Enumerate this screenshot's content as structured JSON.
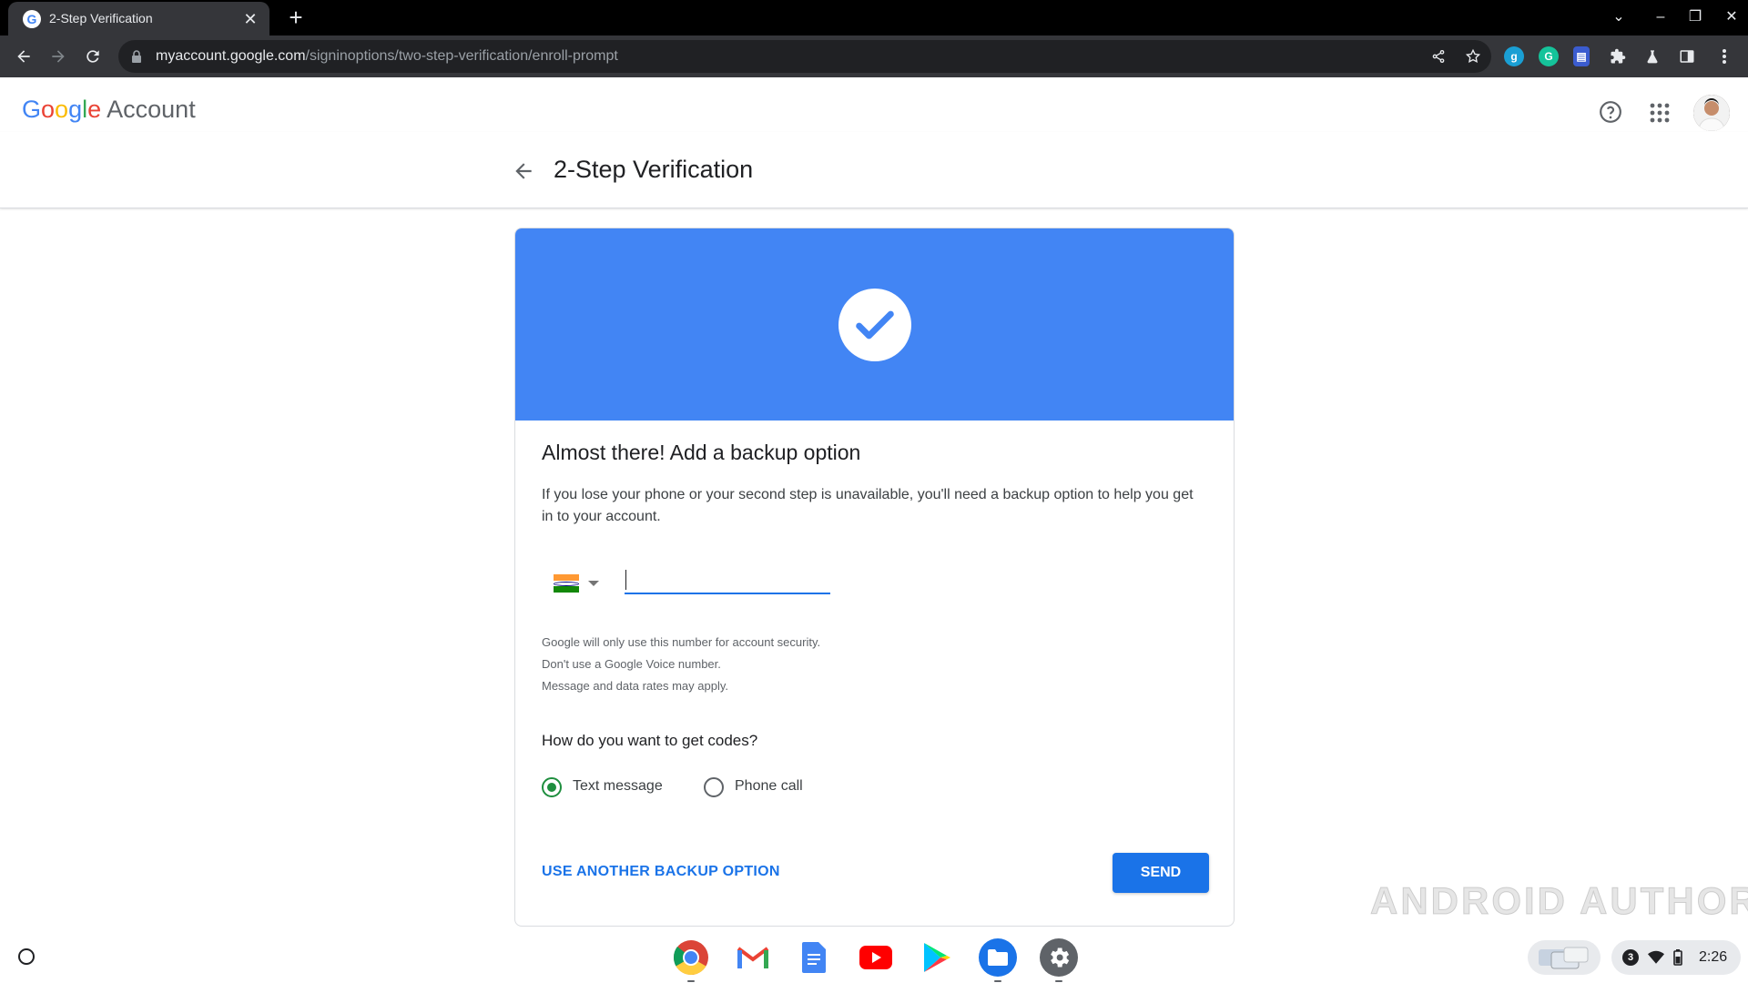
{
  "browser": {
    "tab_title": "2-Step Verification",
    "url_host": "myaccount.google.com",
    "url_path": "/signinoptions/two-step-verification/enroll-prompt"
  },
  "header": {
    "logo_google": "Google",
    "logo_account": "Account"
  },
  "page": {
    "title": "2-Step Verification"
  },
  "card": {
    "title": "Almost there! Add a backup option",
    "description": "If you lose your phone or your second step is unavailable, you'll need a backup option to help you get in to your account.",
    "phone_value": "",
    "country_flag": "India",
    "notes": [
      "Google will only use this number for account security.",
      "Don't use a Google Voice number.",
      "Message and data rates may apply."
    ],
    "question": "How do you want to get codes?",
    "options": [
      {
        "label": "Text message",
        "selected": true
      },
      {
        "label": "Phone call",
        "selected": false
      }
    ],
    "alt_option_label": "USE ANOTHER BACKUP OPTION",
    "send_label": "SEND"
  },
  "watermark": "ANDROID AUTHORITY",
  "shelf": {
    "apps": [
      "chrome-icon",
      "gmail-icon",
      "docs-icon",
      "youtube-icon",
      "play-store-icon",
      "files-icon",
      "settings-icon"
    ],
    "notification_count": "3",
    "time": "2:26"
  },
  "colors": {
    "brand_blue": "#4285f4",
    "action_blue": "#1a73e8",
    "radio_green": "#1e8e3e"
  }
}
